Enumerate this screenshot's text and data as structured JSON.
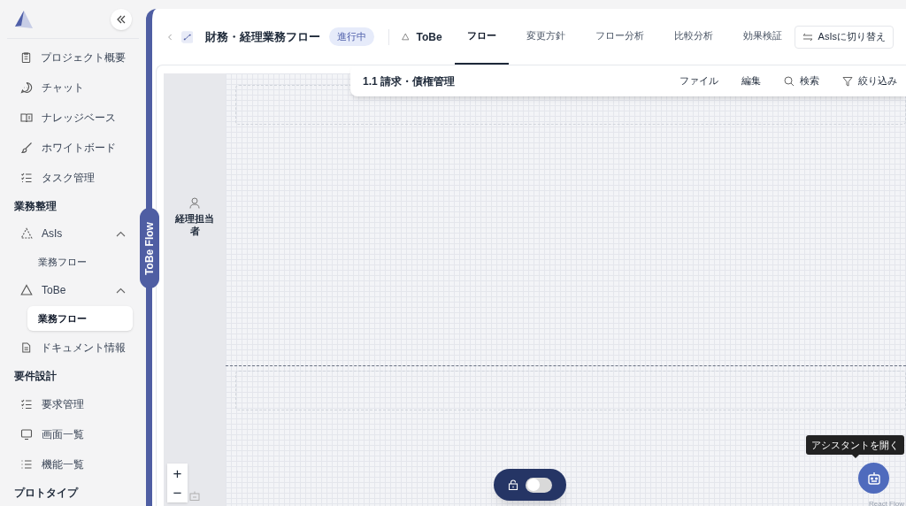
{
  "sidebar": {
    "items": [
      {
        "kind": "link",
        "label": "プロジェクト概要",
        "selected": false
      },
      {
        "kind": "link",
        "label": "チャット",
        "selected": false
      },
      {
        "kind": "link",
        "label": "ナレッジベース",
        "selected": false
      },
      {
        "kind": "link",
        "label": "ホワイトボード",
        "selected": false
      },
      {
        "kind": "link",
        "label": "タスク管理",
        "selected": false
      },
      {
        "kind": "heading",
        "label": "業務整理"
      },
      {
        "kind": "group",
        "label": "AsIs",
        "expanded": true,
        "children": [
          {
            "label": "業務フロー",
            "selected": false
          }
        ]
      },
      {
        "kind": "group",
        "label": "ToBe",
        "expanded": true,
        "children": [
          {
            "label": "業務フロー",
            "selected": true
          }
        ]
      },
      {
        "kind": "link",
        "label": "ドキュメント情報",
        "selected": false
      },
      {
        "kind": "heading",
        "label": "要件設計"
      },
      {
        "kind": "link",
        "label": "要求管理",
        "selected": false
      },
      {
        "kind": "link",
        "label": "画面一覧",
        "selected": false
      },
      {
        "kind": "link",
        "label": "機能一覧",
        "selected": false
      },
      {
        "kind": "heading",
        "label": "プロトタイプ"
      }
    ]
  },
  "side_tab": "ToBe Flow",
  "header": {
    "title": "財務・経理業務フロー",
    "status": "進行中",
    "mode": "ToBe",
    "tabs": [
      {
        "label": "フロー",
        "selected": true
      },
      {
        "label": "変更方針",
        "selected": false
      },
      {
        "label": "フロー分析",
        "selected": false
      },
      {
        "label": "比較分析",
        "selected": false
      },
      {
        "label": "効果検証",
        "selected": false
      }
    ],
    "switch_button": "AsIsに切り替え"
  },
  "toolbar": {
    "title": "1.1 請求・債権管理",
    "menu": [
      {
        "kind": "plain",
        "label": "ファイル"
      },
      {
        "kind": "plain",
        "label": "編集"
      },
      {
        "kind": "search",
        "label": "検索"
      },
      {
        "kind": "filter",
        "label": "絞り込み"
      }
    ]
  },
  "lane": {
    "label": "経理担当者"
  },
  "zoom": {
    "in": "+",
    "out": "−"
  },
  "lock_switch": {
    "on": false
  },
  "assistant": {
    "tooltip": "アシスタントを開く"
  },
  "attribution": "React Flow"
}
